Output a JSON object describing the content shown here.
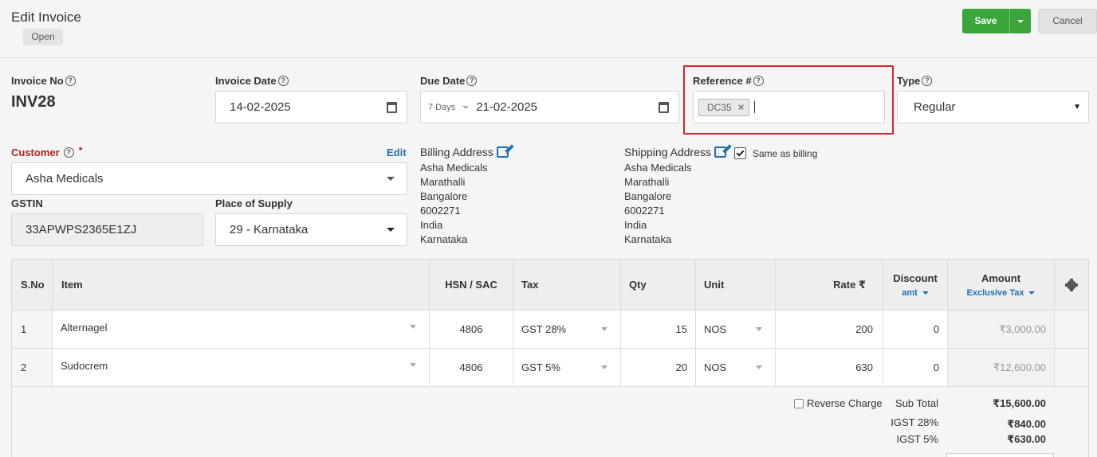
{
  "header": {
    "title": "Edit Invoice",
    "status": "Open",
    "save_label": "Save",
    "cancel_label": "Cancel"
  },
  "invoice_no": {
    "label": "Invoice No",
    "value": "INV28"
  },
  "invoice_date": {
    "label": "Invoice Date",
    "value": "14-02-2025"
  },
  "due_date": {
    "label": "Due Date",
    "terms": "7 Days",
    "value": "21-02-2025"
  },
  "reference": {
    "label": "Reference #",
    "tags": [
      "DC35"
    ]
  },
  "type": {
    "label": "Type",
    "value": "Regular"
  },
  "customer": {
    "label": "Customer",
    "required": "*",
    "edit_label": "Edit",
    "value": "Asha Medicals"
  },
  "gstin": {
    "label": "GSTIN",
    "value": "33APWPS2365E1ZJ"
  },
  "place_of_supply": {
    "label": "Place of Supply",
    "value": "29 - Karnataka"
  },
  "billing_address": {
    "title": "Billing Address",
    "lines": [
      "Asha Medicals",
      "Marathalli",
      "Bangalore",
      "6002271",
      "India",
      "Karnataka"
    ]
  },
  "shipping_address": {
    "title": "Shipping Address",
    "same_as_billing_label": "Same as billing",
    "same_as_billing_checked": true,
    "lines": [
      "Asha Medicals",
      "Marathalli",
      "Bangalore",
      "6002271",
      "India",
      "Karnataka"
    ]
  },
  "table": {
    "headers": {
      "sno": "S.No",
      "item": "Item",
      "hsn": "HSN / SAC",
      "tax": "Tax",
      "qty": "Qty",
      "unit": "Unit",
      "rate": "Rate ₹",
      "discount": "Discount",
      "discount_sub": "amt",
      "amount": "Amount",
      "amount_sub": "Exclusive Tax"
    },
    "rows": [
      {
        "sno": "1",
        "item": "Alternagel",
        "hsn": "4806",
        "tax": "GST 28%",
        "qty": "15",
        "unit": "NOS",
        "rate": "200",
        "discount": "0",
        "amount": "₹3,000.00"
      },
      {
        "sno": "2",
        "item": "Sudocrem",
        "hsn": "4806",
        "tax": "GST 5%",
        "qty": "20",
        "unit": "NOS",
        "rate": "630",
        "discount": "0",
        "amount": "₹12,600.00"
      }
    ]
  },
  "summary": {
    "reverse_charge_label": "Reverse Charge",
    "reverse_charge_checked": false,
    "subtotal_label": "Sub Total",
    "subtotal_value": "₹15,600.00",
    "taxes": [
      {
        "label": "IGST 28%",
        "value": "₹840.00"
      },
      {
        "label": "IGST 5%",
        "value": "₹630.00"
      }
    ]
  },
  "colors": {
    "accent": "#1f6fb5",
    "save_green": "#3aa53a",
    "highlight_red": "#d9262c",
    "required_red": "#b22222"
  }
}
